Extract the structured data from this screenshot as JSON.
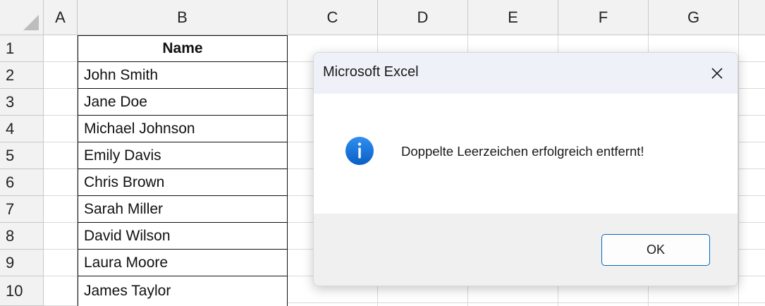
{
  "columns": [
    "A",
    "B",
    "C",
    "D",
    "E",
    "F",
    "G"
  ],
  "rows": [
    "1",
    "2",
    "3",
    "4",
    "5",
    "6",
    "7",
    "8",
    "9",
    "10"
  ],
  "cells": {
    "b1": "Name",
    "b2": "John Smith",
    "b3": "Jane Doe",
    "b4": "Michael Johnson",
    "b5": "Emily Davis",
    "b6": "Chris Brown",
    "b7": "Sarah Miller",
    "b8": "David Wilson",
    "b9": "Laura Moore",
    "b10": "James Taylor"
  },
  "dialog": {
    "title": "Microsoft Excel",
    "message": "Doppelte Leerzeichen erfolgreich entfernt!",
    "ok_label": "OK",
    "icon": "info-icon"
  },
  "colors": {
    "info_blue": "#0a72d6",
    "button_border": "#0067c0",
    "title_bar": "#eef2f8",
    "footer": "#f0f0f0"
  }
}
